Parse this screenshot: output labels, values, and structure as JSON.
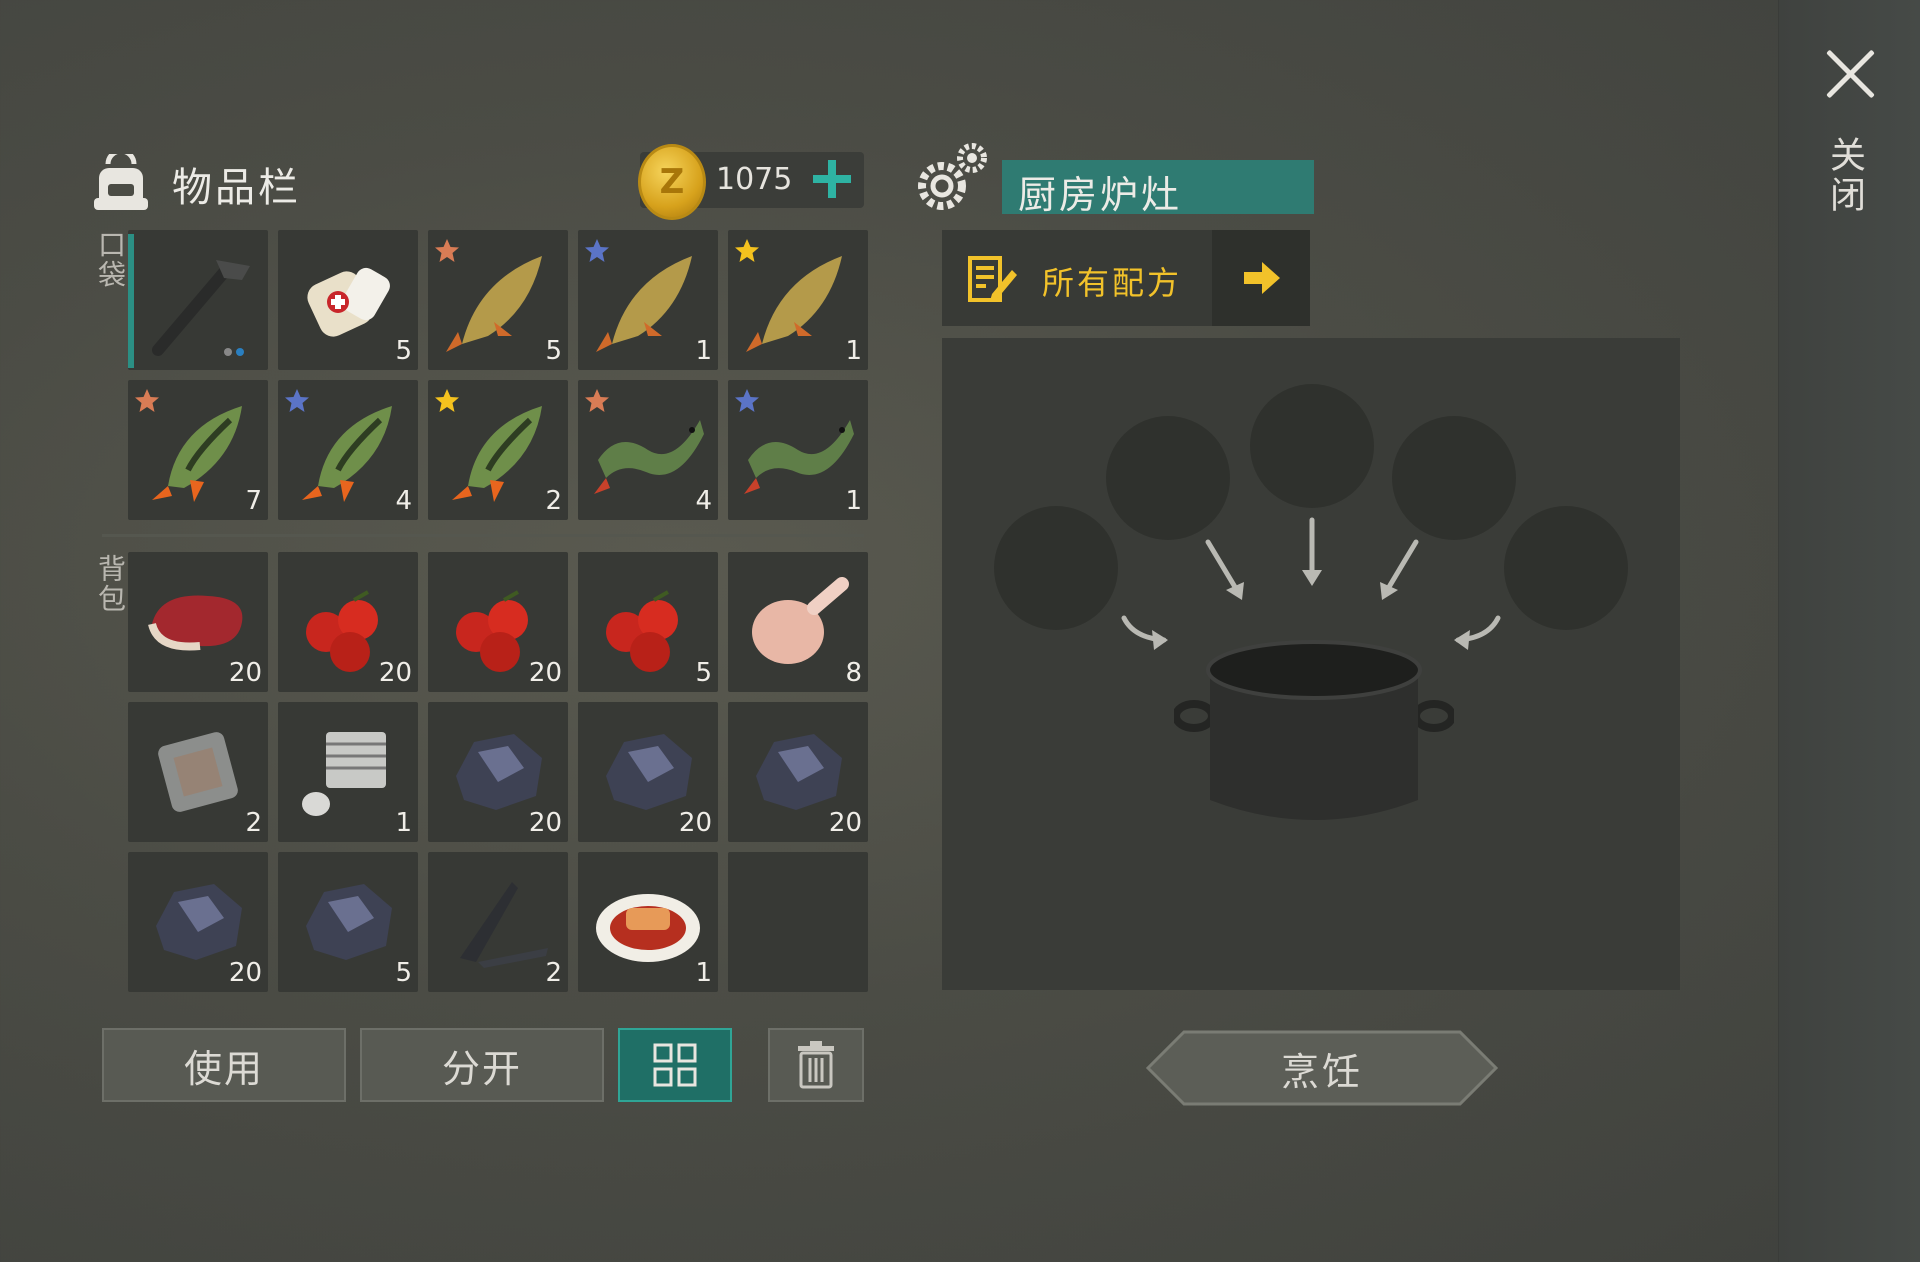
{
  "close": {
    "label": "关闭"
  },
  "inventory": {
    "title": "物品栏",
    "coins": "1075",
    "pocket_label": "口袋",
    "backpack_label": "背包",
    "pocket_slots": [
      {
        "item": "pipe-wrench",
        "count": "",
        "star": ""
      },
      {
        "item": "bandage",
        "count": "5",
        "star": ""
      },
      {
        "item": "carp",
        "count": "5",
        "star": "bronze"
      },
      {
        "item": "carp",
        "count": "1",
        "star": "blue"
      },
      {
        "item": "carp",
        "count": "1",
        "star": "gold"
      },
      {
        "item": "perch",
        "count": "7",
        "star": "bronze"
      },
      {
        "item": "perch",
        "count": "4",
        "star": "blue"
      },
      {
        "item": "perch",
        "count": "2",
        "star": "gold"
      },
      {
        "item": "pike",
        "count": "4",
        "star": "bronze"
      },
      {
        "item": "pike",
        "count": "1",
        "star": "blue"
      }
    ],
    "backpack_slots": [
      {
        "item": "steak",
        "count": "20"
      },
      {
        "item": "berries",
        "count": "20"
      },
      {
        "item": "berries",
        "count": "20"
      },
      {
        "item": "berries",
        "count": "5"
      },
      {
        "item": "raw-chicken",
        "count": "8"
      },
      {
        "item": "iron-plate",
        "count": "2"
      },
      {
        "item": "engine-part",
        "count": "1"
      },
      {
        "item": "ore",
        "count": "20"
      },
      {
        "item": "ore",
        "count": "20"
      },
      {
        "item": "ore",
        "count": "20"
      },
      {
        "item": "ore",
        "count": "20"
      },
      {
        "item": "ore",
        "count": "5"
      },
      {
        "item": "scrap-metal",
        "count": "2"
      },
      {
        "item": "cooked-dish",
        "count": "1"
      },
      {
        "item": "empty",
        "count": ""
      }
    ],
    "buttons": {
      "use": "使用",
      "split": "分开"
    }
  },
  "station": {
    "title": "厨房炉灶",
    "recipe_label": "所有配方",
    "cook_label": "烹饪"
  },
  "colors": {
    "accent": "#2f7b72",
    "recipe": "#f2c22a",
    "coin": "#e0b02c"
  }
}
